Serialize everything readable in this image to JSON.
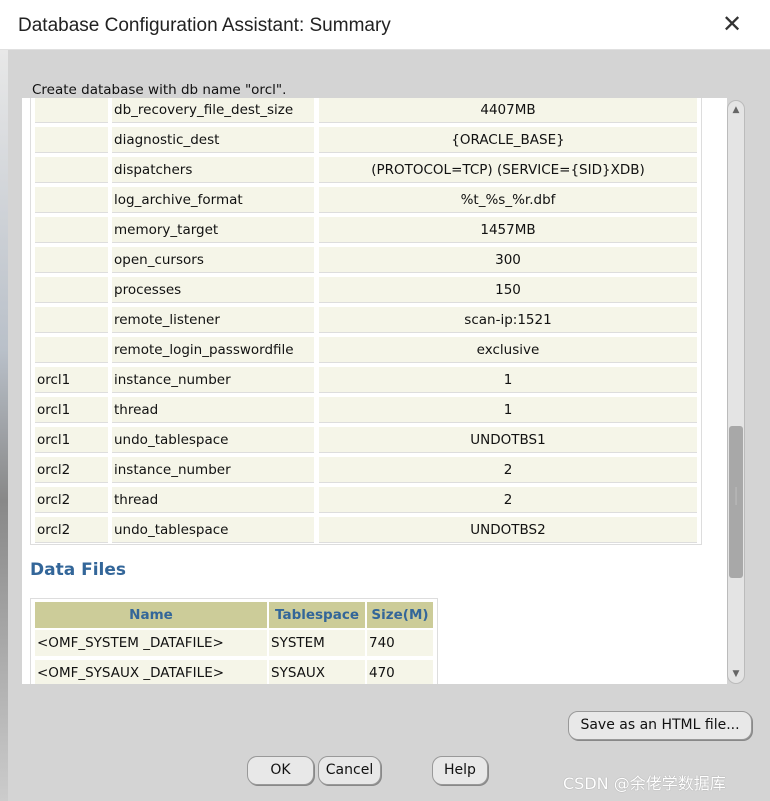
{
  "window": {
    "title": "Database Configuration Assistant: Summary",
    "close": "✕"
  },
  "intro": "Create database with db name \"orcl\".",
  "params": [
    [
      "",
      "db_recovery_file_dest_size",
      "4407MB"
    ],
    [
      "",
      "diagnostic_dest",
      "{ORACLE_BASE}"
    ],
    [
      "",
      "dispatchers",
      "(PROTOCOL=TCP) (SERVICE={SID}XDB)"
    ],
    [
      "",
      "log_archive_format",
      "%t_%s_%r.dbf"
    ],
    [
      "",
      "memory_target",
      "1457MB"
    ],
    [
      "",
      "open_cursors",
      "300"
    ],
    [
      "",
      "processes",
      "150"
    ],
    [
      "",
      "remote_listener",
      "scan-ip:1521"
    ],
    [
      "",
      "remote_login_passwordfile",
      "exclusive"
    ],
    [
      "orcl1",
      "instance_number",
      "1"
    ],
    [
      "orcl1",
      "thread",
      "1"
    ],
    [
      "orcl1",
      "undo_tablespace",
      "UNDOTBS1"
    ],
    [
      "orcl2",
      "instance_number",
      "2"
    ],
    [
      "orcl2",
      "thread",
      "2"
    ],
    [
      "orcl2",
      "undo_tablespace",
      "UNDOTBS2"
    ]
  ],
  "data_files": {
    "heading": "Data Files",
    "columns": [
      "Name",
      "Tablespace",
      "Size(M)"
    ],
    "rows": [
      [
        "<OMF_SYSTEM _DATAFILE>",
        "SYSTEM",
        "740"
      ],
      [
        "<OMF_SYSAUX _DATAFILE>",
        "SYSAUX",
        "470"
      ]
    ]
  },
  "buttons": {
    "save_html": "Save as an HTML file...",
    "ok": "OK",
    "cancel": "Cancel",
    "help": "Help"
  },
  "watermark": "CSDN @余佬学数据库",
  "colors": {
    "heading": "#336699",
    "header_bg": "#cccc99",
    "cell_bg": "#f5f5e8"
  }
}
